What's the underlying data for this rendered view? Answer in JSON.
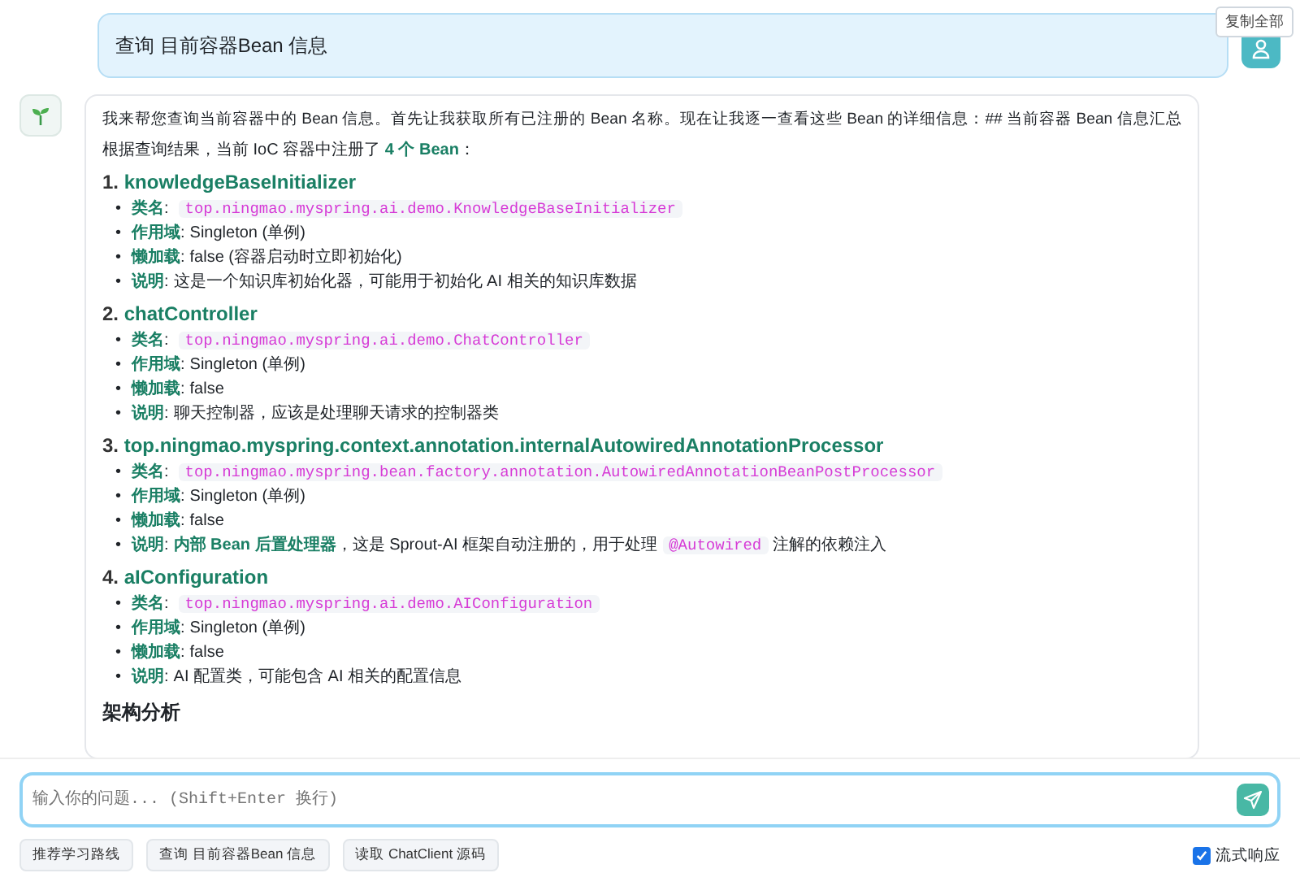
{
  "copy_all_button": "复制全部",
  "user_message": {
    "text": "查询 目前容器Bean 信息"
  },
  "assistant_message": {
    "intro": "我来帮您查询当前容器中的 Bean 信息。首先让我获取所有已注册的 Bean 名称。现在让我逐一查看这些 Bean 的详细信息：## 当前容器 Bean 信息汇总",
    "summary": "根据查询结果，当前 IoC 容器中注册了 **4 个 Bean**：",
    "beans": [
      {
        "number": "1.",
        "name": "knowledgeBaseInitializer",
        "fields": [
          {
            "bullet": "•",
            "label": "类名",
            "colon": ":",
            "segments": [
              {
                "kind": "code",
                "text": "top.ningmao.myspring.ai.demo.KnowledgeBaseInitializer"
              }
            ]
          },
          {
            "bullet": "•",
            "label": "作用域",
            "colon": ":",
            "segments": [
              {
                "kind": "text",
                "text": "Singleton (单例)"
              }
            ]
          },
          {
            "bullet": "•",
            "label": "懒加载",
            "colon": ":",
            "segments": [
              {
                "kind": "text",
                "text": "false (容器启动时立即初始化)"
              }
            ]
          },
          {
            "bullet": "•",
            "label": "说明",
            "colon": ":",
            "segments": [
              {
                "kind": "text",
                "text": "这是一个知识库初始化器，可能用于初始化 AI 相关的知识库数据"
              }
            ]
          }
        ]
      },
      {
        "number": "2.",
        "name": "chatController",
        "fields": [
          {
            "bullet": "•",
            "label": "类名",
            "colon": ":",
            "segments": [
              {
                "kind": "code",
                "text": "top.ningmao.myspring.ai.demo.ChatController"
              }
            ]
          },
          {
            "bullet": "•",
            "label": "作用域",
            "colon": ":",
            "segments": [
              {
                "kind": "text",
                "text": "Singleton (单例)"
              }
            ]
          },
          {
            "bullet": "•",
            "label": "懒加载",
            "colon": ":",
            "segments": [
              {
                "kind": "text",
                "text": "false"
              }
            ]
          },
          {
            "bullet": "•",
            "label": "说明",
            "colon": ":",
            "segments": [
              {
                "kind": "text",
                "text": "聊天控制器，应该是处理聊天请求的控制器类"
              }
            ]
          }
        ]
      },
      {
        "number": "3.",
        "name": "top.ningmao.myspring.context.annotation.internalAutowiredAnnotationProcessor",
        "fields": [
          {
            "bullet": "•",
            "label": "类名",
            "colon": ":",
            "segments": [
              {
                "kind": "code",
                "text": "top.ningmao.myspring.bean.factory.annotation.AutowiredAnnotationBeanPostProcessor"
              }
            ]
          },
          {
            "bullet": "•",
            "label": "作用域",
            "colon": ":",
            "segments": [
              {
                "kind": "text",
                "text": "Singleton (单例)"
              }
            ]
          },
          {
            "bullet": "•",
            "label": "懒加载",
            "colon": ":",
            "segments": [
              {
                "kind": "text",
                "text": "false"
              }
            ]
          },
          {
            "bullet": "•",
            "label": "说明",
            "colon": ":",
            "segments": [
              {
                "kind": "bold",
                "text": "内部 Bean 后置处理器"
              },
              {
                "kind": "text",
                "text": "，这是 Sprout-AI 框架自动注册的，用于处理"
              },
              {
                "kind": "code",
                "text": "@Autowired"
              },
              {
                "kind": "text",
                "text": "注解的依赖注入"
              }
            ]
          }
        ]
      },
      {
        "number": "4.",
        "name": "aIConfiguration",
        "fields": [
          {
            "bullet": "•",
            "label": "类名",
            "colon": ":",
            "segments": [
              {
                "kind": "code",
                "text": "top.ningmao.myspring.ai.demo.AIConfiguration"
              }
            ]
          },
          {
            "bullet": "•",
            "label": "作用域",
            "colon": ":",
            "segments": [
              {
                "kind": "text",
                "text": "Singleton (单例)"
              }
            ]
          },
          {
            "bullet": "•",
            "label": "懒加载",
            "colon": ":",
            "segments": [
              {
                "kind": "text",
                "text": "false"
              }
            ]
          },
          {
            "bullet": "•",
            "label": "说明",
            "colon": ":",
            "segments": [
              {
                "kind": "text",
                "text": "AI 配置类，可能包含 AI 相关的配置信息"
              }
            ]
          }
        ]
      }
    ],
    "section_heading": "架构分析"
  },
  "composer": {
    "placeholder": "输入你的问题... (Shift+Enter 换行)"
  },
  "suggestions": [
    "推荐学习路线",
    "查询 目前容器Bean 信息",
    "读取 ChatClient 源码"
  ],
  "stream_toggle": {
    "label": "流式响应",
    "checked": true
  }
}
